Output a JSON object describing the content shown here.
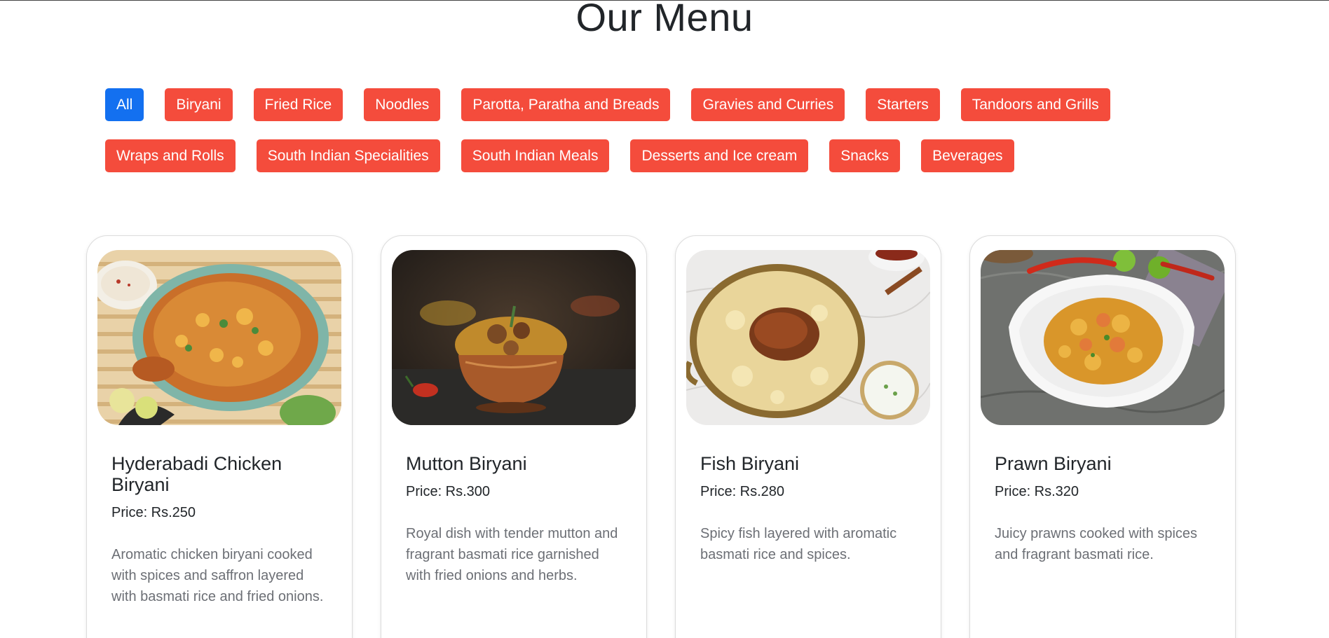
{
  "page": {
    "title": "Our Menu"
  },
  "filters": {
    "row1": [
      {
        "label": "All",
        "active": true
      },
      {
        "label": "Biryani",
        "active": false
      },
      {
        "label": "Fried Rice",
        "active": false
      },
      {
        "label": "Noodles",
        "active": false
      },
      {
        "label": "Parotta, Paratha and Breads",
        "active": false
      },
      {
        "label": "Gravies and Curries",
        "active": false
      },
      {
        "label": "Starters",
        "active": false
      },
      {
        "label": "Tandoors and Grills",
        "active": false
      }
    ],
    "row2": [
      {
        "label": "Wraps and Rolls",
        "active": false
      },
      {
        "label": "South Indian Specialities",
        "active": false
      },
      {
        "label": "South Indian Meals",
        "active": false
      },
      {
        "label": "Desserts and Ice cream",
        "active": false
      },
      {
        "label": "Snacks",
        "active": false
      },
      {
        "label": "Beverages",
        "active": false
      }
    ]
  },
  "colors": {
    "filter_bg": "#f44c3c",
    "filter_active_bg": "#1370f0"
  },
  "menu_items": [
    {
      "name": "Hyderabadi Chicken Biryani",
      "price": "Price: Rs.250",
      "description": "Aromatic chicken biryani cooked with spices and saffron layered with basmati rice and fried onions."
    },
    {
      "name": "Mutton Biryani",
      "price": "Price: Rs.300",
      "description": "Royal dish with tender mutton and fragrant basmati rice garnished with fried onions and herbs."
    },
    {
      "name": "Fish Biryani",
      "price": "Price: Rs.280",
      "description": "Spicy fish layered with aromatic basmati rice and spices."
    },
    {
      "name": "Prawn Biryani",
      "price": "Price: Rs.320",
      "description": "Juicy prawns cooked with spices and fragrant basmati rice."
    }
  ]
}
